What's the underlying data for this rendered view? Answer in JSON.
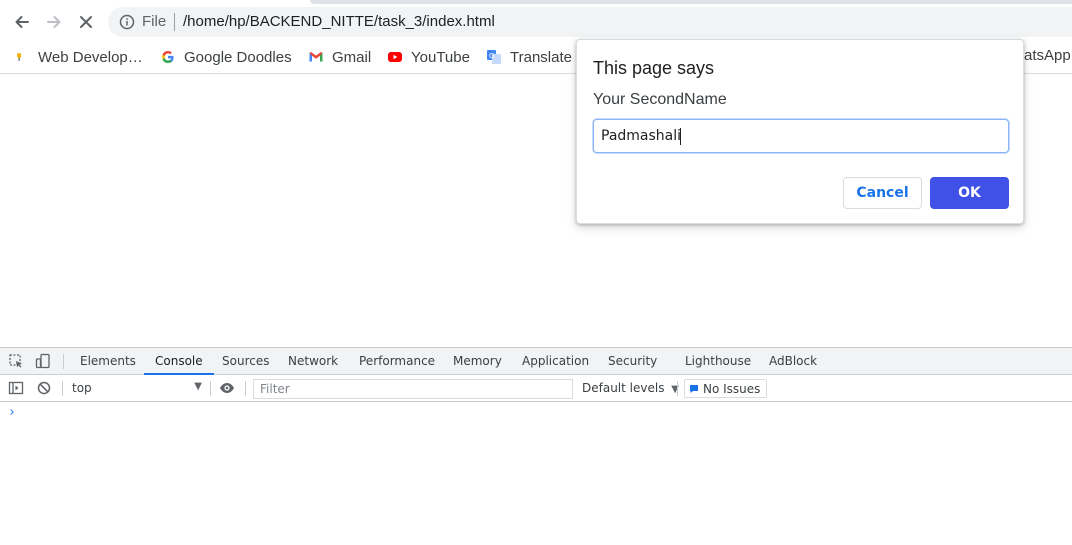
{
  "browser": {
    "omnibox": {
      "scheme_label": "File",
      "url": "/home/hp/BACKEND_NITTE/task_3/index.html"
    },
    "bookmarks": [
      {
        "label": "Web Develop…",
        "icon": "bookmark-pin-icon"
      },
      {
        "label": "Google Doodles",
        "icon": "google-icon"
      },
      {
        "label": "Gmail",
        "icon": "gmail-icon"
      },
      {
        "label": "YouTube",
        "icon": "youtube-icon"
      },
      {
        "label": "Translate",
        "icon": "translate-icon"
      },
      {
        "label": "atsApp",
        "icon": "whatsapp-icon"
      }
    ]
  },
  "dialog": {
    "title": "This page says",
    "message": "Your SecondName",
    "input_value": "Padmashali",
    "cancel_label": "Cancel",
    "ok_label": "OK"
  },
  "devtools": {
    "tabs": [
      {
        "label": "Elements",
        "active": false
      },
      {
        "label": "Console",
        "active": true
      },
      {
        "label": "Sources",
        "active": false
      },
      {
        "label": "Network",
        "active": false
      },
      {
        "label": "Performance",
        "active": false
      },
      {
        "label": "Memory",
        "active": false
      },
      {
        "label": "Application",
        "active": false
      },
      {
        "label": "Security",
        "active": false
      },
      {
        "label": "Lighthouse",
        "active": false
      },
      {
        "label": "AdBlock",
        "active": false
      }
    ],
    "toolbar": {
      "context": "top",
      "filter_placeholder": "Filter",
      "levels_label": "Default levels",
      "issues_label": "No Issues"
    },
    "console_prompt": "›"
  },
  "colors": {
    "accent": "#1a73e8",
    "ok_button": "#3f51e6",
    "chrome_bg": "#f1f3f4"
  }
}
